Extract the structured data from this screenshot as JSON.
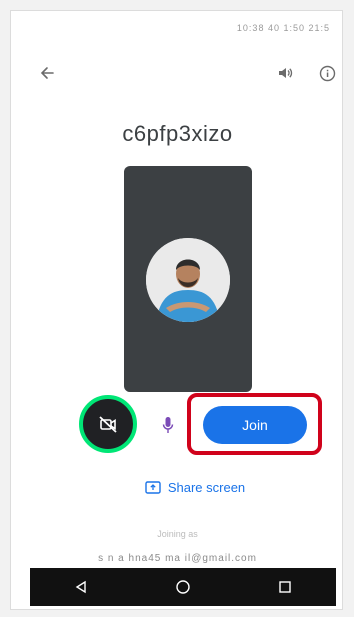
{
  "status_bar": {
    "text": "10:38 40 1:50 21:5"
  },
  "header": {
    "back_icon": "arrow-left-icon",
    "speaker_icon": "volume-icon",
    "info_icon": "info-icon"
  },
  "meeting": {
    "code": "c6pfp3xizo"
  },
  "controls": {
    "camera_icon": "camera-off-icon",
    "mic_icon": "mic-icon",
    "join_label": "Join",
    "share_label": "Share screen",
    "highlight_colors": {
      "camera": "#00e676",
      "join": "#d0021b"
    },
    "join_color": "#1a73e8"
  },
  "footer": {
    "joining_as": "Joining as",
    "account": "s n a    hna45 ma il@gmail.com"
  },
  "navbar": {
    "back_icon": "triangle-back-icon",
    "home_icon": "circle-home-icon",
    "recents_icon": "square-recents-icon"
  }
}
